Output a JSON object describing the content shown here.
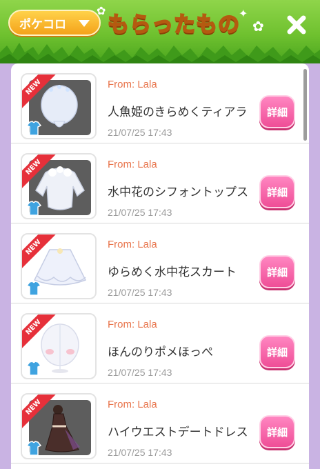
{
  "header": {
    "dropdown_label": "ポケコロ",
    "title": "もらったもの"
  },
  "items": [
    {
      "from": "From: Lala",
      "name": "人魚姫のきらめくティアラ",
      "date": "21/07/25 17:43",
      "badge": "NEW",
      "button": "詳細",
      "icon": "tiara-icon",
      "thumb_bg": "dark"
    },
    {
      "from": "From: Lala",
      "name": "水中花のシフォントップス",
      "date": "21/07/25 17:43",
      "badge": "NEW",
      "button": "詳細",
      "icon": "tops-icon",
      "thumb_bg": "dark"
    },
    {
      "from": "From: Lala",
      "name": "ゆらめく水中花スカート",
      "date": "21/07/25 17:43",
      "badge": "NEW",
      "button": "詳細",
      "icon": "skirt-icon",
      "thumb_bg": "light"
    },
    {
      "from": "From: Lala",
      "name": "ほんのりポメほっぺ",
      "date": "21/07/25 17:43",
      "badge": "NEW",
      "button": "詳細",
      "icon": "cheek-icon",
      "thumb_bg": "light"
    },
    {
      "from": "From: Lala",
      "name": "ハイウエストデートドレス",
      "date": "21/07/25 17:43",
      "badge": "NEW",
      "button": "詳細",
      "icon": "dress-icon",
      "thumb_bg": "dark"
    }
  ],
  "colors": {
    "header_green": "#6fc12f",
    "from_text": "#e8734a",
    "detail_button": "#ef4e97",
    "new_ribbon": "#e6303a",
    "background_purple": "#c9b3e3"
  }
}
